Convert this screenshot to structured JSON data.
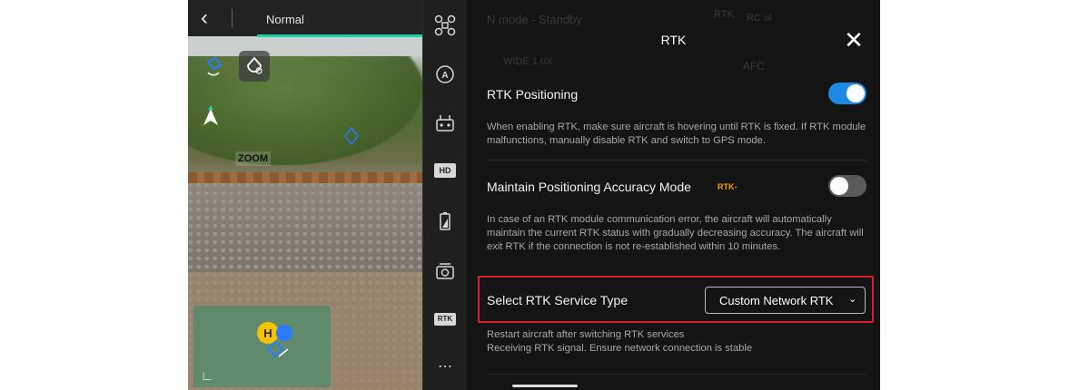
{
  "camera": {
    "mode_label": "Normal",
    "zoom_label": "ZOOM"
  },
  "rail": {
    "hd_label": "HD",
    "rtk_label": "RTK"
  },
  "background_status": {
    "mode": "N mode - Standby",
    "rtk": "RTK",
    "rc": "RC ul",
    "focus": "AFC",
    "exposure": "WIDE 1.0X"
  },
  "panel": {
    "title": "RTK",
    "rtk_positioning": {
      "label": "RTK Positioning",
      "enabled": true,
      "description": "When enabling RTK, make sure aircraft is hovering until RTK is fixed. If RTK module malfunctions, manually disable RTK and switch to GPS mode."
    },
    "accuracy_mode": {
      "label": "Maintain Positioning Accuracy Mode",
      "tag": "RTK-",
      "enabled": false,
      "description": "In case of an RTK module communication error, the aircraft will automatically maintain the current RTK status with gradually decreasing accuracy. The aircraft will exit RTK if the connection is not re-established within 10 minutes."
    },
    "service_type": {
      "label": "Select RTK Service Type",
      "value": "Custom Network RTK",
      "note1": "Restart aircraft after switching RTK services",
      "note2": "Receiving RTK signal. Ensure network connection is stable"
    }
  },
  "colors": {
    "accent_blue": "#1e88e5",
    "highlight_red": "#d32030",
    "tag_orange": "#ff9d00",
    "status_green": "#19d3a2"
  }
}
